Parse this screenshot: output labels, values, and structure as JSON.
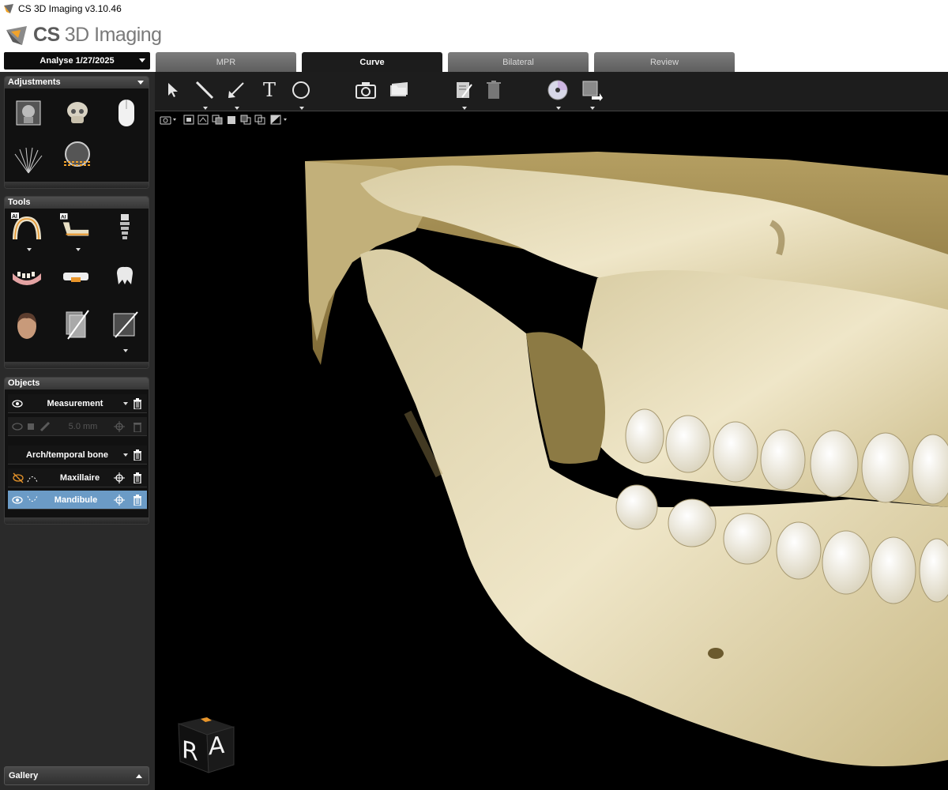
{
  "window": {
    "title": "CS 3D Imaging v3.10.46"
  },
  "brand": {
    "cs": "CS",
    "rest": "3D Imaging"
  },
  "study": {
    "label": "Analyse 1/27/2025"
  },
  "tabs": [
    {
      "label": "MPR",
      "active": false
    },
    {
      "label": "Curve",
      "active": true
    },
    {
      "label": "Bilateral",
      "active": false
    },
    {
      "label": "Review",
      "active": false
    }
  ],
  "panels": {
    "adjustments": {
      "title": "Adjustments"
    },
    "tools": {
      "title": "Tools",
      "ai_badge": "AI"
    },
    "objects": {
      "title": "Objects",
      "measurement": {
        "label": "Measurement",
        "value": "5.0 mm"
      },
      "arch": {
        "label": "Arch/temporal bone"
      },
      "items": [
        {
          "label": "Maxillaire",
          "selected": false
        },
        {
          "label": "Mandibule",
          "selected": true
        }
      ]
    },
    "gallery": {
      "title": "Gallery"
    }
  },
  "toolbar": {
    "text_tool": "T"
  },
  "orientation": {
    "label_r": "R",
    "label_a": "A"
  },
  "colors": {
    "selected_row": "#6b9bc6",
    "bone": "#e9dcb8",
    "panel_bg": "#2a2a2a"
  }
}
